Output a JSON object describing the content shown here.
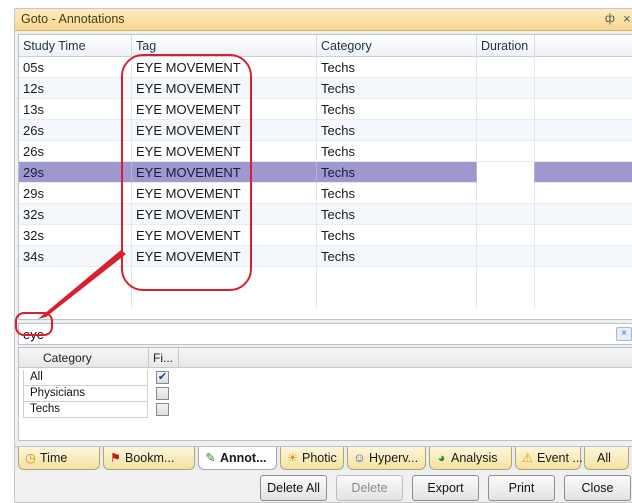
{
  "window": {
    "title": "Goto - Annotations",
    "pin_glyph": "ф",
    "close_glyph": "×"
  },
  "grid": {
    "columns": [
      "Study Time",
      "Tag",
      "Category",
      "Duration"
    ],
    "rows": [
      {
        "time": "05s",
        "tag": "EYE MOVEMENT",
        "category": "Techs",
        "duration": ""
      },
      {
        "time": "12s",
        "tag": "EYE MOVEMENT",
        "category": "Techs",
        "duration": ""
      },
      {
        "time": "13s",
        "tag": "EYE MOVEMENT",
        "category": "Techs",
        "duration": ""
      },
      {
        "time": "26s",
        "tag": "EYE MOVEMENT",
        "category": "Techs",
        "duration": ""
      },
      {
        "time": "26s",
        "tag": "EYE MOVEMENT",
        "category": "Techs",
        "duration": ""
      },
      {
        "time": "29s",
        "tag": "EYE MOVEMENT",
        "category": "Techs",
        "duration": "",
        "selected": true
      },
      {
        "time": "29s",
        "tag": "EYE MOVEMENT",
        "category": "Techs",
        "duration": ""
      },
      {
        "time": "32s",
        "tag": "EYE MOVEMENT",
        "category": "Techs",
        "duration": ""
      },
      {
        "time": "32s",
        "tag": "EYE MOVEMENT",
        "category": "Techs",
        "duration": ""
      },
      {
        "time": "34s",
        "tag": "EYE MOVEMENT",
        "category": "Techs",
        "duration": ""
      }
    ]
  },
  "filter": {
    "value": "eye",
    "clear_glyph": "×"
  },
  "category_filter": {
    "headers": [
      "Category",
      "Fi..."
    ],
    "items": [
      {
        "label": "All",
        "checked": true
      },
      {
        "label": "Physicians",
        "checked": false
      },
      {
        "label": "Techs",
        "checked": false
      }
    ]
  },
  "tabs": [
    {
      "label": "Time",
      "icon": "clock-icon",
      "glyph": "◷",
      "color": "#d88a10"
    },
    {
      "label": "Bookm...",
      "icon": "flag-icon",
      "glyph": "⚑",
      "color": "#c81818"
    },
    {
      "label": "Annot...",
      "icon": "pencil-icon",
      "glyph": "✎",
      "color": "#3a8a1a",
      "active": true
    },
    {
      "label": "Photic",
      "icon": "lightbulb-icon",
      "glyph": "☀",
      "color": "#d8a010"
    },
    {
      "label": "Hyperv...",
      "icon": "person-icon",
      "glyph": "☺",
      "color": "#3060c0"
    },
    {
      "label": "Analysis",
      "icon": "pie-chart-icon",
      "glyph": "◕",
      "color": "#2a8a2a"
    },
    {
      "label": "Event ...",
      "icon": "warning-icon",
      "glyph": "⚠",
      "color": "#e0a000"
    },
    {
      "label": "All",
      "icon": "",
      "glyph": "",
      "color": ""
    }
  ],
  "buttons": {
    "delete_all": "Delete All",
    "delete": "Delete",
    "export": "Export",
    "print": "Print",
    "close": "Close"
  },
  "colors": {
    "selection": "#9e98cf",
    "highlight_annotation": "#d6202f",
    "title_bar": "#f7d892"
  }
}
